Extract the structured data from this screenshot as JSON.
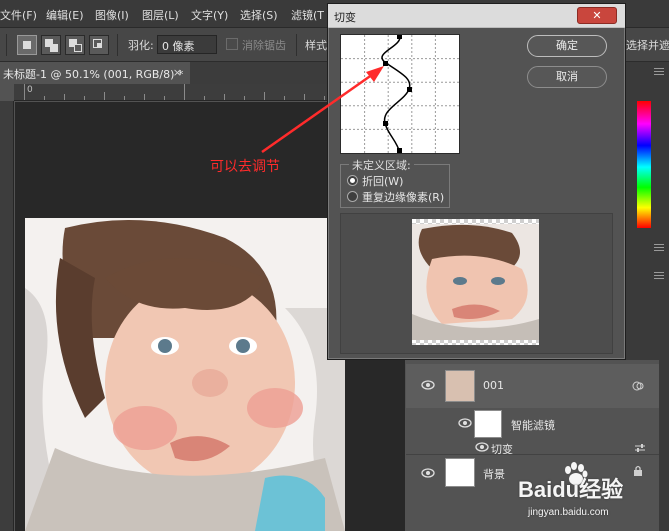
{
  "menu": {
    "items": [
      "文件(F)",
      "编辑(E)",
      "图像(I)",
      "图层(L)",
      "文字(Y)",
      "选择(S)",
      "滤镜(T"
    ]
  },
  "options": {
    "feather_label": "羽化:",
    "feather_value": "0 像素",
    "antialias_label": "消除锯齿",
    "style_label": "样式",
    "select_and_mask": "选择并遮"
  },
  "document": {
    "tab_title": "未标题-1 @ 50.1% (001, RGB/8) *",
    "close_glyph": "×",
    "ruler_zero": "0"
  },
  "dialog": {
    "title": "切变",
    "close_glyph": "✕",
    "ok_label": "确定",
    "cancel_label": "取消",
    "undefined_area_label": "未定义区域:",
    "options": [
      {
        "label": "折回(W)",
        "selected": true
      },
      {
        "label": "重复边缘像素(R)",
        "selected": false
      }
    ]
  },
  "annotation": {
    "text": "可以去调节",
    "color": "#ff2b2b"
  },
  "layers": {
    "items": [
      {
        "name": "001",
        "type": "smart-object"
      },
      {
        "name": "智能滤镜",
        "type": "smart-filters"
      },
      {
        "name": "切变",
        "type": "filter"
      },
      {
        "name": "背景",
        "type": "background",
        "locked": true
      }
    ]
  },
  "watermark": {
    "main": "Baidu经验",
    "sub": "jingyan.baidu.com"
  },
  "colors": {
    "menubar": "#3a3a3a",
    "panel": "#535353",
    "dialog_close": "#c9463d",
    "annotation": "#ff2b2b"
  }
}
